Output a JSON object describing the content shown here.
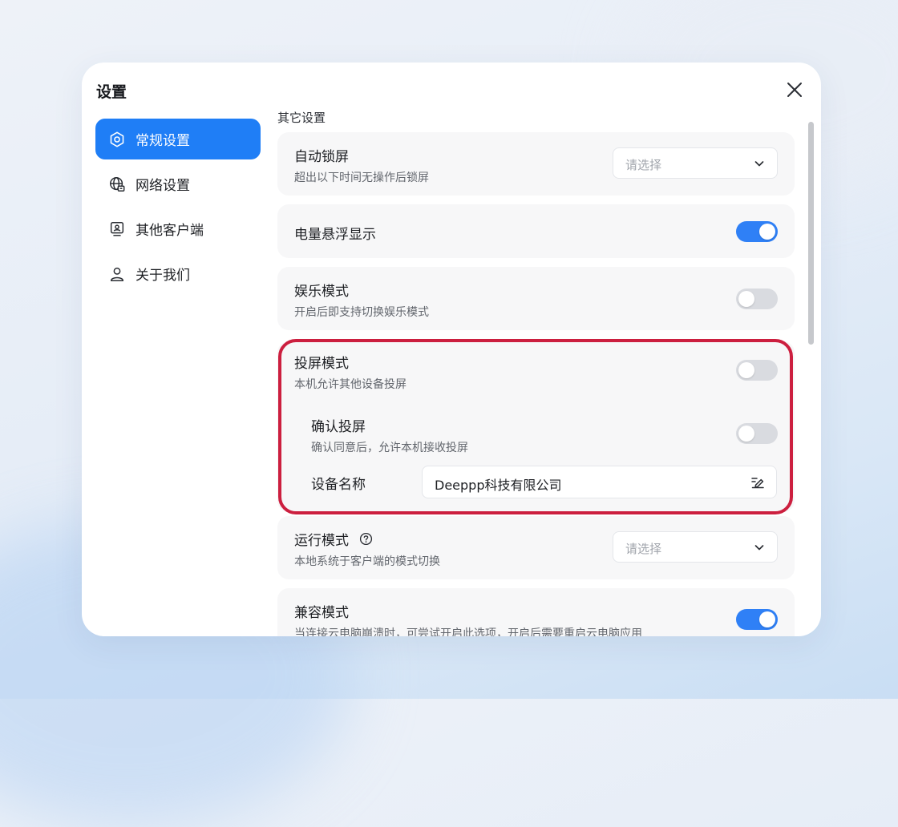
{
  "dialog": {
    "title": "设置"
  },
  "sidebar": {
    "items": [
      {
        "label": "常规设置",
        "icon": "gear-icon",
        "active": true
      },
      {
        "label": "网络设置",
        "icon": "network-globe-icon",
        "active": false
      },
      {
        "label": "其他客户端",
        "icon": "client-monitor-icon",
        "active": false
      },
      {
        "label": "关于我们",
        "icon": "user-icon",
        "active": false
      }
    ]
  },
  "content": {
    "section_title": "其它设置",
    "auto_lock": {
      "title": "自动锁屏",
      "desc": "超出以下时间无操作后锁屏",
      "placeholder": "请选择"
    },
    "battery_float": {
      "title": "电量悬浮显示",
      "enabled": true
    },
    "entertainment": {
      "title": "娱乐模式",
      "desc": "开启后即支持切换娱乐模式",
      "enabled": false
    },
    "cast_mode": {
      "title": "投屏模式",
      "desc": "本机允许其他设备投屏",
      "enabled": false,
      "confirm": {
        "title": "确认投屏",
        "desc": "确认同意后，允许本机接收投屏",
        "enabled": false
      },
      "device_name": {
        "label": "设备名称",
        "value": "Deeppp科技有限公司"
      }
    },
    "run_mode": {
      "title": "运行模式",
      "desc": "本地系统于客户端的模式切换",
      "placeholder": "请选择"
    },
    "compat_mode": {
      "title": "兼容模式",
      "desc": "当连接云电脑崩溃时，可尝试开启此选项，开启后需要重启云电脑应用",
      "enabled": true
    }
  },
  "colors": {
    "accent": "#1f7ef6",
    "toggle_on": "#2f80f6",
    "highlight": "#cc1f3f"
  }
}
